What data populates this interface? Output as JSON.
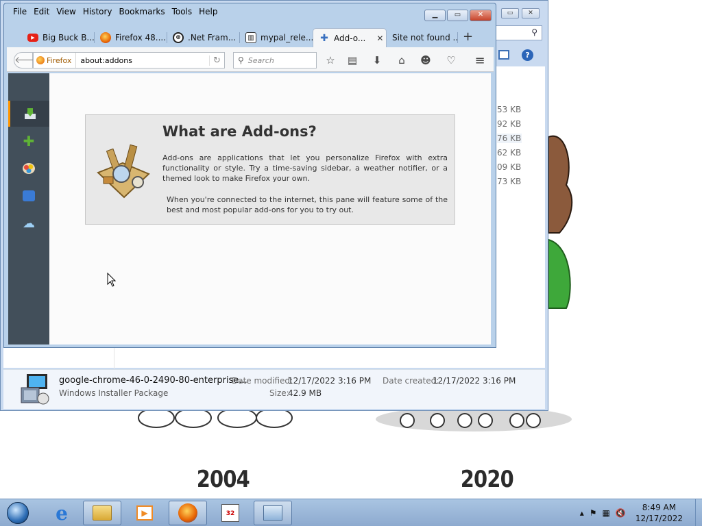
{
  "desktop": {
    "years": [
      "2004",
      "2020"
    ]
  },
  "explorer": {
    "sizes": [
      "53 KB",
      "92 KB",
      "76 KB",
      "62 KB",
      "09 KB",
      "73 KB"
    ],
    "details": {
      "filename": "google-chrome-46-0-2490-80-enterprise...",
      "type": "Windows Installer Package",
      "modified_label": "Date modified:",
      "modified_value": "12/17/2022 3:16 PM",
      "created_label": "Date created:",
      "created_value": "12/17/2022 3:16 PM",
      "size_label": "Size:",
      "size_value": "42.9 MB"
    }
  },
  "firefox": {
    "menu": [
      "File",
      "Edit",
      "View",
      "History",
      "Bookmarks",
      "Tools",
      "Help"
    ],
    "tabs": [
      {
        "label": "Big Buck B...",
        "icon": "youtube-icon"
      },
      {
        "label": "Firefox 48....",
        "icon": "firefox-icon"
      },
      {
        "label": ".Net Fram...",
        "icon": "dotnet-icon"
      },
      {
        "label": "mypal_rele...",
        "icon": "github-icon"
      },
      {
        "label": "Add-o...",
        "icon": "puzzle-icon",
        "active": true
      },
      {
        "label": "Site not found ...",
        "icon": "none"
      }
    ],
    "identity_label": "Firefox",
    "url": "about:addons",
    "search_placeholder": "Search",
    "addons": {
      "title": "What are Add-ons?",
      "para1": "Add-ons are applications that let you personalize Firefox with extra functionality or style. Try a time-saving sidebar, a weather notifier, or a themed look to make Firefox your own.",
      "para2": "When you're connected to the internet, this pane will feature some of the best and most popular add-ons for you to try out."
    },
    "sidebar": [
      "get-addons",
      "extensions",
      "appearance",
      "plugins",
      "services"
    ]
  },
  "taskbar": {
    "time": "8:49 AM",
    "date": "12/17/2022"
  }
}
